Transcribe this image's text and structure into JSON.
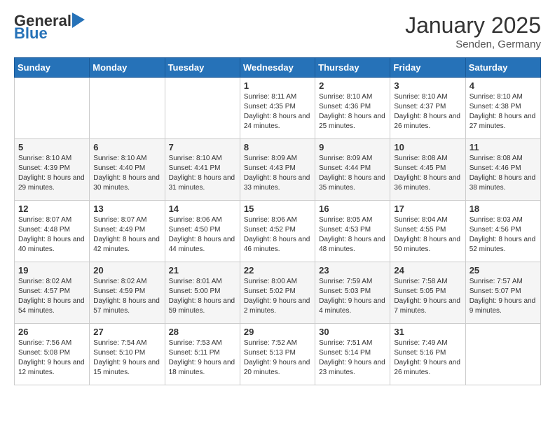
{
  "header": {
    "logo_general": "General",
    "logo_blue": "Blue",
    "month_title": "January 2025",
    "location": "Senden, Germany"
  },
  "weekdays": [
    "Sunday",
    "Monday",
    "Tuesday",
    "Wednesday",
    "Thursday",
    "Friday",
    "Saturday"
  ],
  "weeks": [
    [
      {
        "day": "",
        "info": ""
      },
      {
        "day": "",
        "info": ""
      },
      {
        "day": "",
        "info": ""
      },
      {
        "day": "1",
        "info": "Sunrise: 8:11 AM\nSunset: 4:35 PM\nDaylight: 8 hours\nand 24 minutes."
      },
      {
        "day": "2",
        "info": "Sunrise: 8:10 AM\nSunset: 4:36 PM\nDaylight: 8 hours\nand 25 minutes."
      },
      {
        "day": "3",
        "info": "Sunrise: 8:10 AM\nSunset: 4:37 PM\nDaylight: 8 hours\nand 26 minutes."
      },
      {
        "day": "4",
        "info": "Sunrise: 8:10 AM\nSunset: 4:38 PM\nDaylight: 8 hours\nand 27 minutes."
      }
    ],
    [
      {
        "day": "5",
        "info": "Sunrise: 8:10 AM\nSunset: 4:39 PM\nDaylight: 8 hours\nand 29 minutes."
      },
      {
        "day": "6",
        "info": "Sunrise: 8:10 AM\nSunset: 4:40 PM\nDaylight: 8 hours\nand 30 minutes."
      },
      {
        "day": "7",
        "info": "Sunrise: 8:10 AM\nSunset: 4:41 PM\nDaylight: 8 hours\nand 31 minutes."
      },
      {
        "day": "8",
        "info": "Sunrise: 8:09 AM\nSunset: 4:43 PM\nDaylight: 8 hours\nand 33 minutes."
      },
      {
        "day": "9",
        "info": "Sunrise: 8:09 AM\nSunset: 4:44 PM\nDaylight: 8 hours\nand 35 minutes."
      },
      {
        "day": "10",
        "info": "Sunrise: 8:08 AM\nSunset: 4:45 PM\nDaylight: 8 hours\nand 36 minutes."
      },
      {
        "day": "11",
        "info": "Sunrise: 8:08 AM\nSunset: 4:46 PM\nDaylight: 8 hours\nand 38 minutes."
      }
    ],
    [
      {
        "day": "12",
        "info": "Sunrise: 8:07 AM\nSunset: 4:48 PM\nDaylight: 8 hours\nand 40 minutes."
      },
      {
        "day": "13",
        "info": "Sunrise: 8:07 AM\nSunset: 4:49 PM\nDaylight: 8 hours\nand 42 minutes."
      },
      {
        "day": "14",
        "info": "Sunrise: 8:06 AM\nSunset: 4:50 PM\nDaylight: 8 hours\nand 44 minutes."
      },
      {
        "day": "15",
        "info": "Sunrise: 8:06 AM\nSunset: 4:52 PM\nDaylight: 8 hours\nand 46 minutes."
      },
      {
        "day": "16",
        "info": "Sunrise: 8:05 AM\nSunset: 4:53 PM\nDaylight: 8 hours\nand 48 minutes."
      },
      {
        "day": "17",
        "info": "Sunrise: 8:04 AM\nSunset: 4:55 PM\nDaylight: 8 hours\nand 50 minutes."
      },
      {
        "day": "18",
        "info": "Sunrise: 8:03 AM\nSunset: 4:56 PM\nDaylight: 8 hours\nand 52 minutes."
      }
    ],
    [
      {
        "day": "19",
        "info": "Sunrise: 8:02 AM\nSunset: 4:57 PM\nDaylight: 8 hours\nand 54 minutes."
      },
      {
        "day": "20",
        "info": "Sunrise: 8:02 AM\nSunset: 4:59 PM\nDaylight: 8 hours\nand 57 minutes."
      },
      {
        "day": "21",
        "info": "Sunrise: 8:01 AM\nSunset: 5:00 PM\nDaylight: 8 hours\nand 59 minutes."
      },
      {
        "day": "22",
        "info": "Sunrise: 8:00 AM\nSunset: 5:02 PM\nDaylight: 9 hours\nand 2 minutes."
      },
      {
        "day": "23",
        "info": "Sunrise: 7:59 AM\nSunset: 5:03 PM\nDaylight: 9 hours\nand 4 minutes."
      },
      {
        "day": "24",
        "info": "Sunrise: 7:58 AM\nSunset: 5:05 PM\nDaylight: 9 hours\nand 7 minutes."
      },
      {
        "day": "25",
        "info": "Sunrise: 7:57 AM\nSunset: 5:07 PM\nDaylight: 9 hours\nand 9 minutes."
      }
    ],
    [
      {
        "day": "26",
        "info": "Sunrise: 7:56 AM\nSunset: 5:08 PM\nDaylight: 9 hours\nand 12 minutes."
      },
      {
        "day": "27",
        "info": "Sunrise: 7:54 AM\nSunset: 5:10 PM\nDaylight: 9 hours\nand 15 minutes."
      },
      {
        "day": "28",
        "info": "Sunrise: 7:53 AM\nSunset: 5:11 PM\nDaylight: 9 hours\nand 18 minutes."
      },
      {
        "day": "29",
        "info": "Sunrise: 7:52 AM\nSunset: 5:13 PM\nDaylight: 9 hours\nand 20 minutes."
      },
      {
        "day": "30",
        "info": "Sunrise: 7:51 AM\nSunset: 5:14 PM\nDaylight: 9 hours\nand 23 minutes."
      },
      {
        "day": "31",
        "info": "Sunrise: 7:49 AM\nSunset: 5:16 PM\nDaylight: 9 hours\nand 26 minutes."
      },
      {
        "day": "",
        "info": ""
      }
    ]
  ]
}
